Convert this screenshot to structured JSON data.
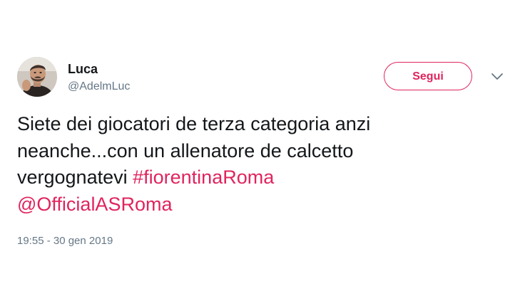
{
  "author": {
    "name": "Luca",
    "handle": "@AdelmLuc",
    "avatar_icon": "user-avatar-photo"
  },
  "follow_button": {
    "label": "Segui",
    "color": "#e0245e"
  },
  "menu": {
    "icon": "chevron-down-icon"
  },
  "tweet": {
    "text_line_1": "Siete dei giocatori de terza categoria anzi",
    "text_line_2": "neanche...con un allenatore de calcetto",
    "text_line_3_plain": "vergognatevi",
    "hashtag": "#fiorentinaRoma",
    "mention": "@OfficialASRoma",
    "timestamp": "19:55 - 30 gen 2019"
  },
  "colors": {
    "text": "#14171a",
    "secondary": "#657786",
    "accent": "#e0245e",
    "background": "#ffffff"
  }
}
